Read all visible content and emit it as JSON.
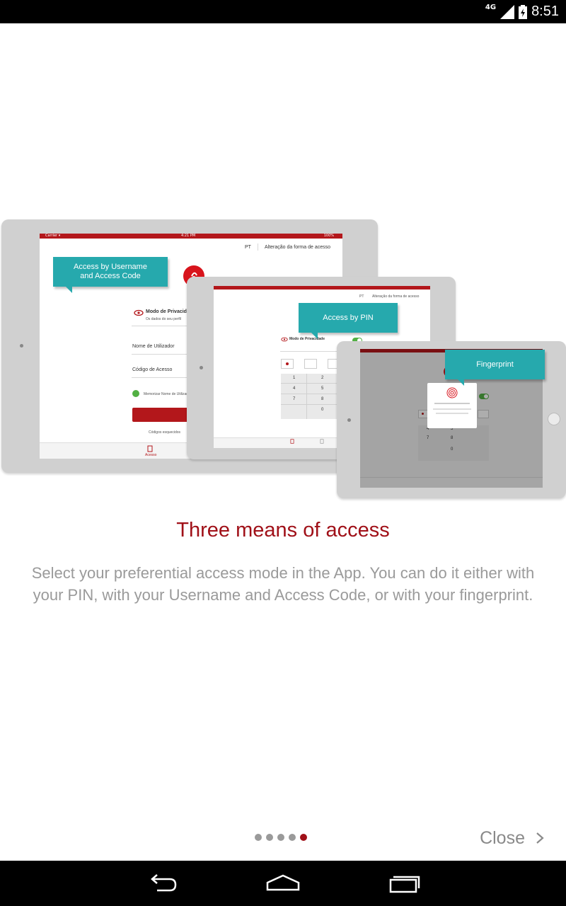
{
  "status_bar": {
    "network": "4G",
    "time": "8:51"
  },
  "illustration": {
    "callouts": {
      "username": "Access by Username and Access Code",
      "pin": "Access by PIN",
      "fingerprint": "Fingerprint"
    }
  },
  "content": {
    "title": "Three means of access",
    "description": "Select your preferential access mode in the App. You can do it either with your PIN, with your Username and Access Code, or with your fingerprint."
  },
  "pager": {
    "total": 5,
    "active_index": 4
  },
  "footer": {
    "close_label": "Close"
  },
  "nav": {
    "back": "back-icon",
    "home": "home-icon",
    "recents": "recents-icon"
  },
  "colors": {
    "accent": "#a01018",
    "callout": "#26a9ad",
    "brand_red": "#d8141c"
  }
}
